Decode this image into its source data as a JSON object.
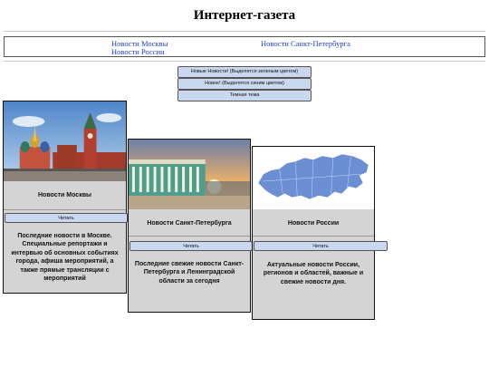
{
  "header": {
    "title": "Интернет-газета"
  },
  "nav": {
    "links": [
      "Новости Москвы",
      "Новости Санкт-Петербурга",
      "Новости России"
    ]
  },
  "controls": [
    "Новые Новости! (Выделятся зеленым цветом)",
    "Новое! (Выделятся синим цветом)",
    "Темная тема"
  ],
  "cards": [
    {
      "title": "Новости Москвы",
      "button": "Читать",
      "description": "Последние новости в Москве. Специальные репортажи и интервью об основных событиях города, афиша мероприятий, а также прямые трансляции с мероприятий",
      "image": "moscow-red-square"
    },
    {
      "title": "Новости Санкт-Петербурга",
      "button": "Читать",
      "description": "Последние свежие новости Санкт-Петербурга и Ленинградской области за сегодня",
      "image": "winter-palace-sunset"
    },
    {
      "title": "Новости России",
      "button": "Читать",
      "description": "Актуальные новости России, регионов и областей, важные и свежие новости дня.",
      "image": "russia-map"
    }
  ],
  "colors": {
    "button_bg": "#c9d7ef",
    "card_bg": "#d4d4d4",
    "link": "#1a3fcf"
  }
}
